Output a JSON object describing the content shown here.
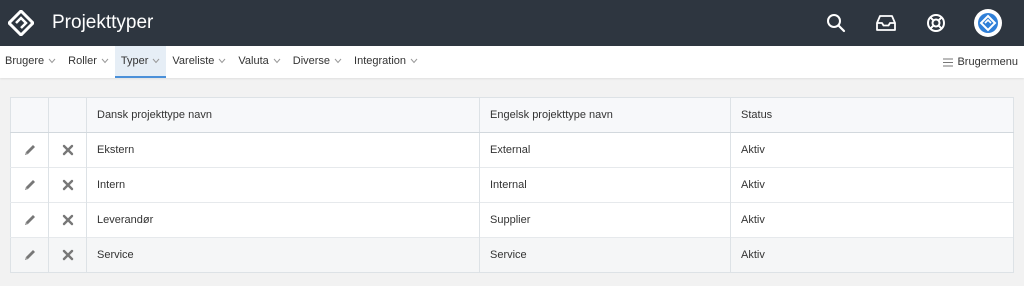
{
  "header": {
    "title": "Projekttyper",
    "icons": [
      "logo-icon",
      "search-icon",
      "inbox-icon",
      "help-icon",
      "user-avatar-icon"
    ]
  },
  "nav": {
    "items": [
      {
        "label": "Brugere"
      },
      {
        "label": "Roller"
      },
      {
        "label": "Typer"
      },
      {
        "label": "Vareliste"
      },
      {
        "label": "Valuta"
      },
      {
        "label": "Diverse"
      },
      {
        "label": "Integration"
      }
    ],
    "active": "Typer",
    "user_menu": "Brugermenu"
  },
  "table": {
    "headers": [
      "Dansk projekttype navn",
      "Engelsk projekttype navn",
      "Status"
    ],
    "rows": [
      {
        "danish": "Ekstern",
        "english": "External",
        "status": "Aktiv"
      },
      {
        "danish": "Intern",
        "english": "Internal",
        "status": "Aktiv"
      },
      {
        "danish": "Leverandør",
        "english": "Supplier",
        "status": "Aktiv"
      },
      {
        "danish": "Service",
        "english": "Service",
        "status": "Aktiv"
      }
    ],
    "row_actions": [
      "edit-icon",
      "delete-icon"
    ]
  },
  "colors": {
    "topbar": "#2e3640",
    "accent": "#4a90d9",
    "page_bg": "#f2f2f2"
  }
}
